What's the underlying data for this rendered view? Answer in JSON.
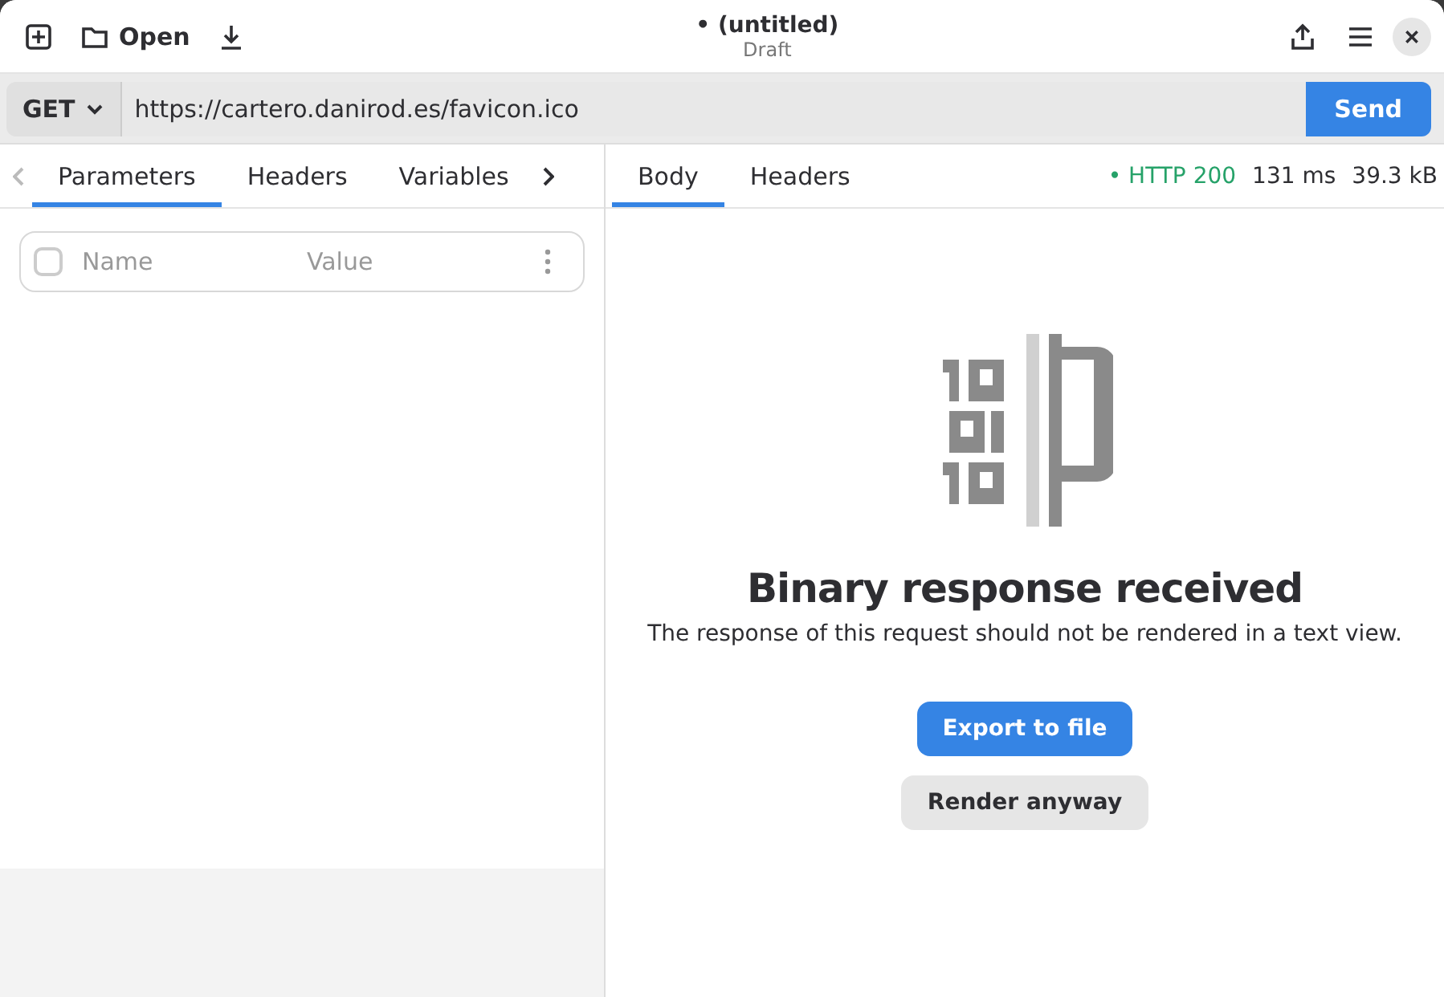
{
  "header": {
    "title": "• (untitled)",
    "subtitle": "Draft",
    "open_label": "Open"
  },
  "request": {
    "method": "GET",
    "url": "https://cartero.danirod.es/favicon.ico",
    "send_label": "Send"
  },
  "request_tabs": [
    {
      "label": "Parameters",
      "selected": true
    },
    {
      "label": "Headers",
      "selected": false
    },
    {
      "label": "Variables",
      "selected": false
    }
  ],
  "params_table": {
    "rows": [
      {
        "checked": false,
        "name_field": {
          "placeholder": "Name"
        },
        "value_field": {
          "placeholder": "Value"
        }
      }
    ]
  },
  "response_tabs": [
    {
      "label": "Body",
      "selected": true
    },
    {
      "label": "Headers",
      "selected": false
    }
  ],
  "response_status": {
    "status": "• HTTP 200",
    "color": "#26a269",
    "time": "131 ms",
    "size": "39.3 kB"
  },
  "binary_notice": {
    "title": "Binary response received",
    "message": "The response of this request should not be rendered in a text view.",
    "buttons": [
      {
        "label": "Export to file",
        "kind": "primary"
      },
      {
        "label": "Render anyway",
        "kind": "secondary"
      }
    ]
  }
}
